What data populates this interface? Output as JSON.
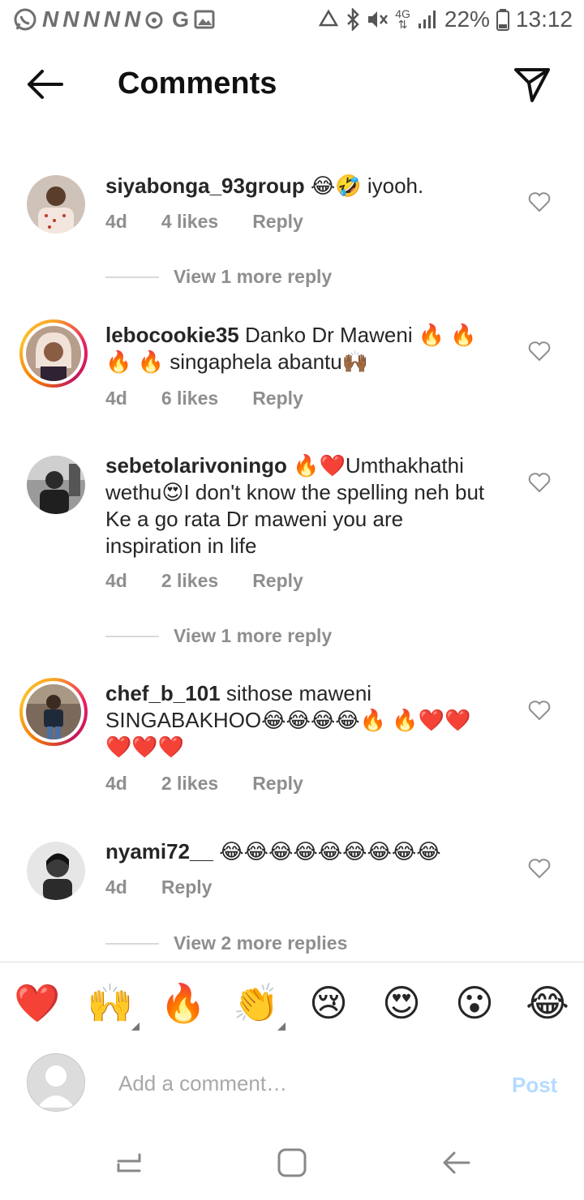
{
  "status_bar": {
    "notification_letters": [
      "N",
      "N",
      "N",
      "N",
      "N"
    ],
    "g_label": "G",
    "network": "4G",
    "battery": "22%",
    "time": "13:12"
  },
  "header": {
    "title": "Comments"
  },
  "comments": [
    {
      "username": "siyabonga_93group",
      "text": "😂🤣 iyooh.",
      "age": "4d",
      "likes": "4 likes",
      "reply": "Reply",
      "view_more": "View 1 more reply"
    },
    {
      "username": "lebocookie35",
      "text": "Danko Dr Maweni 🔥 🔥 🔥 🔥 singaphela abantu🙌🏾",
      "age": "4d",
      "likes": "6 likes",
      "reply": "Reply"
    },
    {
      "username": "sebetolarivoningo",
      "text": "🔥❤️Umthakhathi wethu😍I don't know the spelling neh but Ke a go rata Dr maweni you are inspiration in life",
      "age": "4d",
      "likes": "2 likes",
      "reply": "Reply",
      "view_more": "View 1 more reply"
    },
    {
      "username": "chef_b_101",
      "text": "sithose maweni SINGABAKHOO😂😂😂😂🔥 🔥❤️❤️❤️❤️❤️",
      "age": "4d",
      "likes": "2 likes",
      "reply": "Reply"
    },
    {
      "username": "nyami72__",
      "text": "😂😂😂😂😂😂😂😂😂",
      "age": "4d",
      "reply": "Reply",
      "view_more": "View 2 more replies"
    }
  ],
  "reactions": [
    "❤️",
    "🙌",
    "🔥",
    "👏",
    "😢",
    "😍",
    "😮",
    "😂"
  ],
  "input": {
    "placeholder": "Add a comment…",
    "post_label": "Post"
  },
  "colors": {
    "meta_gray": "#8e8e8e",
    "post_blue": "#b3dbff",
    "heart_red": "#e0245e"
  }
}
